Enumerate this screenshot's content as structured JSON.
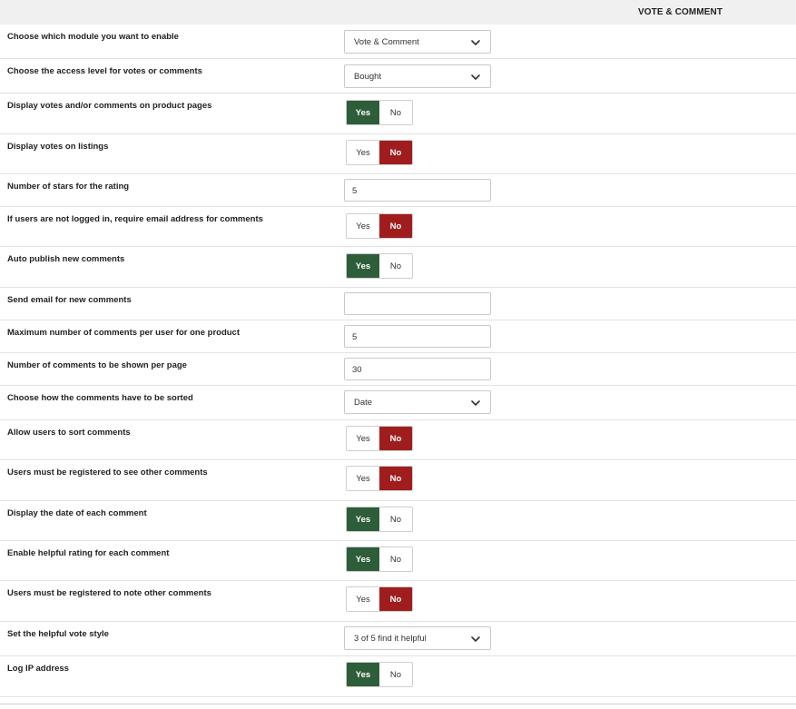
{
  "header": {
    "column_title": "VOTE & COMMENT"
  },
  "settings": [
    {
      "label": "Choose which module you want to enable",
      "type": "select",
      "value": "Vote & Comment"
    },
    {
      "label": "Choose the access level for votes or comments",
      "type": "select",
      "value": "Bought"
    },
    {
      "label": "Display votes and/or comments on product pages",
      "type": "toggle",
      "yes": "Yes",
      "no": "No",
      "selected": "yes"
    },
    {
      "label": "Display votes on listings",
      "type": "toggle",
      "yes": "Yes",
      "no": "No",
      "selected": "no"
    },
    {
      "label": "Number of stars for the rating",
      "type": "input",
      "value": "5"
    },
    {
      "label": "If users are not logged in, require email address for comments",
      "type": "toggle",
      "yes": "Yes",
      "no": "No",
      "selected": "no"
    },
    {
      "label": "Auto publish new comments",
      "type": "toggle",
      "yes": "Yes",
      "no": "No",
      "selected": "yes"
    },
    {
      "label": "Send email for new comments",
      "type": "input",
      "value": ""
    },
    {
      "label": "Maximum number of comments per user for one product",
      "type": "input",
      "value": "5"
    },
    {
      "label": "Number of comments to be shown per page",
      "type": "input",
      "value": "30"
    },
    {
      "label": "Choose how the comments have to be sorted",
      "type": "select",
      "value": "Date"
    },
    {
      "label": "Allow users to sort comments",
      "type": "toggle",
      "yes": "Yes",
      "no": "No",
      "selected": "no"
    },
    {
      "label": "Users must be registered to see other comments",
      "type": "toggle",
      "yes": "Yes",
      "no": "No",
      "selected": "no"
    },
    {
      "label": "Display the date of each comment",
      "type": "toggle",
      "yes": "Yes",
      "no": "No",
      "selected": "yes"
    },
    {
      "label": "Enable helpful rating for each comment",
      "type": "toggle",
      "yes": "Yes",
      "no": "No",
      "selected": "yes"
    },
    {
      "label": "Users must be registered to note other comments",
      "type": "toggle",
      "yes": "Yes",
      "no": "No",
      "selected": "no"
    },
    {
      "label": "Set the helpful vote style",
      "type": "select",
      "value": "3 of 5 find it helpful"
    },
    {
      "label": "Log IP address",
      "type": "toggle",
      "yes": "Yes",
      "no": "No",
      "selected": "yes"
    }
  ],
  "icons": {
    "select_arrow": "chevron-down-icon"
  },
  "colors": {
    "yes_active": "#2e5d3a",
    "no_active": "#a01d1d",
    "header_bg": "#f0f0f0"
  }
}
